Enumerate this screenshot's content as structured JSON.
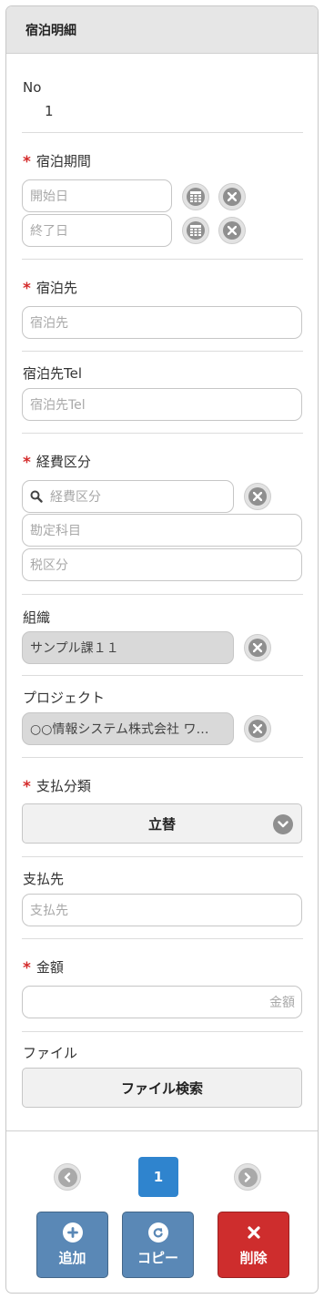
{
  "header": {
    "title": "宿泊明細"
  },
  "no": {
    "label": "No",
    "value": "1"
  },
  "stay_period": {
    "label": "宿泊期間",
    "start_placeholder": "開始日",
    "end_placeholder": "終了日"
  },
  "lodging": {
    "label": "宿泊先",
    "placeholder": "宿泊先"
  },
  "lodging_tel": {
    "label": "宿泊先Tel",
    "placeholder": "宿泊先Tel"
  },
  "expense": {
    "label": "経費区分",
    "search_placeholder": "経費区分",
    "account_placeholder": "勘定科目",
    "tax_placeholder": "税区分"
  },
  "organization": {
    "label": "組織",
    "value": "サンプル課１１"
  },
  "project": {
    "label": "プロジェクト",
    "value": "○○情報システム株式会社 ワ…"
  },
  "payment_type": {
    "label": "支払分類",
    "value": "立替"
  },
  "payee": {
    "label": "支払先",
    "placeholder": "支払先"
  },
  "amount": {
    "label": "金額",
    "placeholder": "金額"
  },
  "file": {
    "label": "ファイル",
    "button": "ファイル検索"
  },
  "pagination": {
    "current": "1"
  },
  "actions": {
    "add": "追加",
    "copy": "コピー",
    "delete": "削除"
  },
  "colors": {
    "required": "#d42b2b",
    "primary": "#2f84ce",
    "action_blue": "#5a88b6",
    "delete_red": "#ce2d2d"
  }
}
